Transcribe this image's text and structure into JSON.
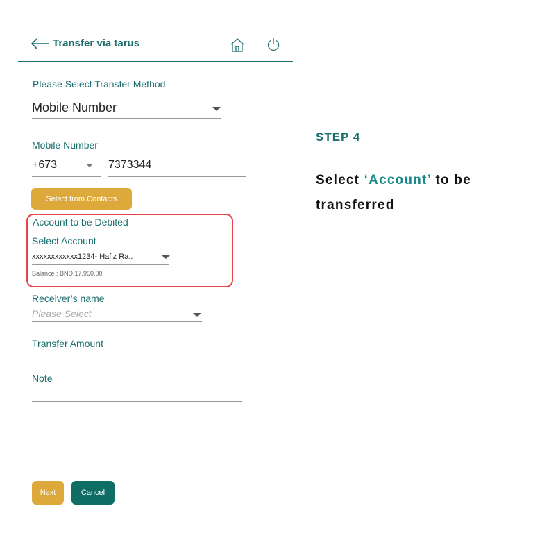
{
  "header": {
    "title": "Transfer via tarus",
    "icons": [
      "back-arrow-icon",
      "home-icon",
      "power-icon"
    ]
  },
  "form": {
    "method_label": "Please Select Transfer Method",
    "method_value": "Mobile Number",
    "mobile_label": "Mobile Number",
    "country_code": "+673",
    "phone_number": "7373344",
    "contacts_button": "Select from Contacts",
    "debit_label": "Account to be Debited",
    "select_account_label": "Select Account",
    "account_value": "xxxxxxxxxxxx1234- Hafiz Ra..",
    "balance": "Balance : BND 17,950.00",
    "receiver_label": "Receiver’s name",
    "receiver_placeholder": "Please Select",
    "amount_label": "Transfer Amount",
    "note_label": "Note"
  },
  "actions": {
    "next": "Next",
    "cancel": "Cancel"
  },
  "instructions": {
    "step": "STEP 4",
    "desc_before": "Select ",
    "desc_highlight": "‘Account’",
    "desc_after": " to be transferred"
  },
  "colors": {
    "primary_teal": "#1a6e6e",
    "gold": "#dca93a",
    "cancel_teal": "#0e6e66",
    "highlight_red": "#e8434b"
  }
}
